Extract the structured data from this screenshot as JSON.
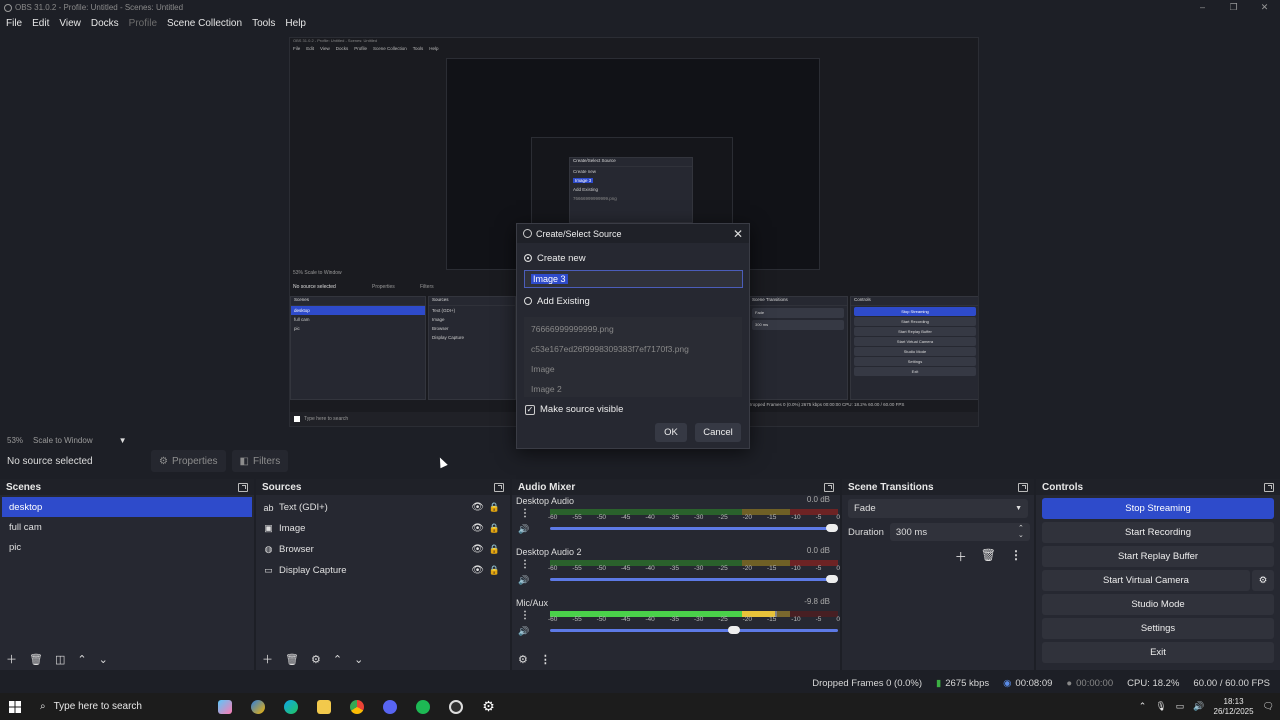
{
  "window": {
    "title": "OBS 31.0.2 - Profile: Untitled - Scenes: Untitled",
    "controls": [
      "–",
      "❐",
      "✕"
    ]
  },
  "menu": {
    "items": [
      "File",
      "Edit",
      "View",
      "Docks",
      "Profile",
      "Scene Collection",
      "Tools",
      "Help"
    ]
  },
  "preview_snapshot": {
    "title": "OBS 31.0.2 - Profile: Untitled - Scenes: Untitled",
    "menu": [
      "File",
      "Edit",
      "View",
      "Docks",
      "Profile",
      "Scene Collection",
      "Tools",
      "Help"
    ],
    "scale": "53%  Scale to Window",
    "no_source": "No source selected",
    "properties": "Properties",
    "filters": "Filters",
    "scenes_title": "Scenes",
    "scenes": [
      "desktop",
      "full cam",
      "pic"
    ],
    "sources_title": "Sources",
    "sources": [
      "Text (GDI+)",
      "Image",
      "Browser",
      "Display Capture"
    ],
    "transitions_title": "Scene Transitions",
    "transition": "Fade",
    "duration": "300 ms",
    "controls_title": "Controls",
    "controls": [
      "Stop Streaming",
      "Start Recording",
      "Start Replay Buffer",
      "Start Virtual Camera",
      "Studio Mode",
      "Settings",
      "Exit"
    ],
    "status": "Dropped Frames 0 (0.0%)   2675 kbps   00:00:00   CPU: 18.2%   60.00 / 60.00 FPS",
    "search": "Type here to search",
    "dlg_title": "Create/Select Source",
    "dlg_create": "Create new",
    "dlg_name": "Image 3",
    "dlg_existing": "Add Existing",
    "dlg_item": "76666999999999.png"
  },
  "scale_bar": {
    "zoom": "53%",
    "mode": "Scale to Window"
  },
  "context": {
    "no_source": "No source selected",
    "properties": "Properties",
    "filters": "Filters"
  },
  "scenes": {
    "title": "Scenes",
    "items": [
      "desktop",
      "full cam",
      "pic"
    ],
    "selected": "desktop"
  },
  "sources": {
    "title": "Sources",
    "items": [
      {
        "name": "Text (GDI+)",
        "icon": "text-icon"
      },
      {
        "name": "Image",
        "icon": "image-icon"
      },
      {
        "name": "Browser",
        "icon": "globe-icon"
      },
      {
        "name": "Display Capture",
        "icon": "monitor-icon"
      }
    ]
  },
  "audio": {
    "title": "Audio Mixer",
    "ticks": [
      "-60",
      "-55",
      "-50",
      "-45",
      "-40",
      "-35",
      "-30",
      "-25",
      "-20",
      "-15",
      "-10",
      "-5",
      "0"
    ],
    "channels": [
      {
        "name": "Desktop Audio",
        "db": "0.0 dB",
        "level": 0,
        "volume": 1.0
      },
      {
        "name": "Desktop Audio 2",
        "db": "0.0 dB",
        "level": 0,
        "volume": 1.0
      },
      {
        "name": "Mic/Aux",
        "db": "-9.8 dB",
        "level": 0.78,
        "volume": 0.66
      }
    ]
  },
  "transitions": {
    "title": "Scene Transitions",
    "selected": "Fade",
    "duration_label": "Duration",
    "duration": "300 ms"
  },
  "controls": {
    "title": "Controls",
    "buttons": [
      "Stop Streaming",
      "Start Recording",
      "Start Replay Buffer",
      "Start Virtual Camera",
      "Studio Mode",
      "Settings",
      "Exit"
    ],
    "active": "Stop Streaming"
  },
  "status": {
    "dropped": "Dropped Frames 0 (0.0%)",
    "kbps": "2675 kbps",
    "stream_time": "00:08:09",
    "rec_time": "00:00:00",
    "cpu": "CPU: 18.2%",
    "fps": "60.00 / 60.00 FPS"
  },
  "taskbar": {
    "search_placeholder": "Type here to search",
    "time": "18:13",
    "date": "26/12/2025"
  },
  "dialog": {
    "title": "Create/Select Source",
    "create_new": "Create new",
    "new_name": "Image 3",
    "add_existing": "Add Existing",
    "existing": [
      "76666999999999.png",
      "c53e167ed26f9998309383f7ef7170f3.png",
      "Image",
      "Image 2"
    ],
    "make_visible": "Make source visible",
    "ok": "OK",
    "cancel": "Cancel"
  },
  "colors": {
    "accent": "#2e4bcb",
    "bg": "#1d1f26",
    "panel": "#262831"
  }
}
